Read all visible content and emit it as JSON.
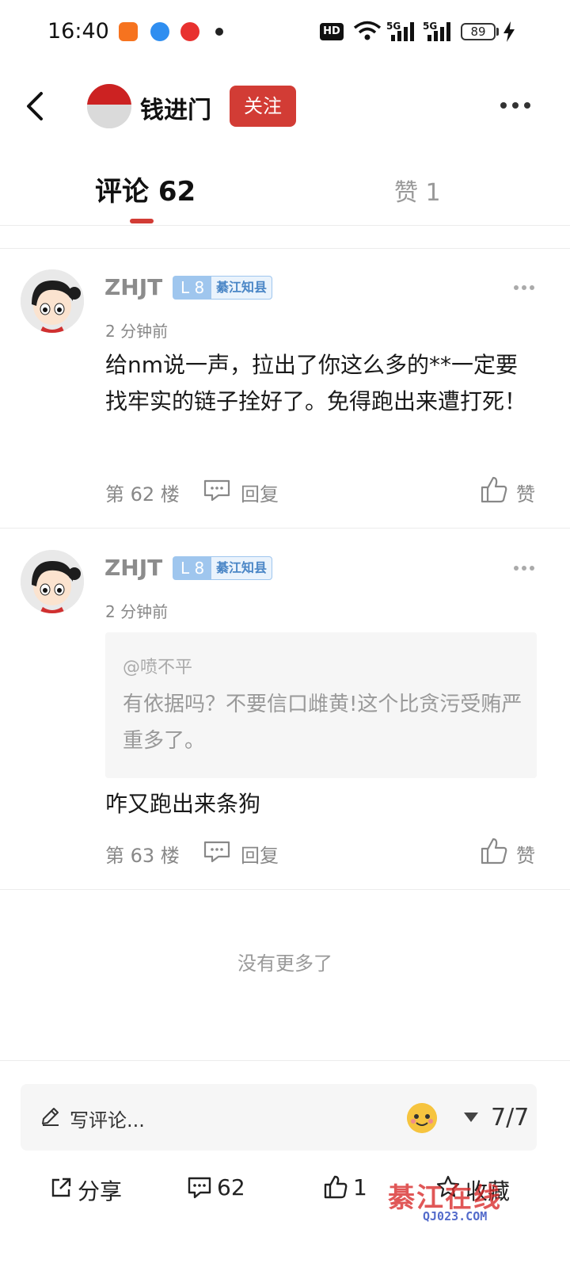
{
  "status_bar": {
    "time": "16:40",
    "network_1": "5G",
    "network_2": "5G",
    "hd": "HD",
    "battery": "89"
  },
  "header": {
    "name": "钱进门",
    "follow_label": "关注"
  },
  "tabs": {
    "comments_label": "评论 62",
    "likes_label": "赞 1"
  },
  "comments": [
    {
      "user": "ZHJT",
      "level": "L 8",
      "title": "綦江知县",
      "time": "2 分钟前",
      "text": "给nm说一声，拉出了你这么多的**一定要找牢实的链子拴好了。免得跑出来遭打死！",
      "floor": "第 62 楼",
      "reply_label": "回复",
      "like_label": "赞"
    },
    {
      "user": "ZHJT",
      "level": "L 8",
      "title": "綦江知县",
      "time": "2 分钟前",
      "quote_user": "@喷不平",
      "quote_text": "有依据吗？不要信口雌黄!这个比贪污受贿严重多了。",
      "text": "咋又跑出来条狗",
      "floor": "第 63 楼",
      "reply_label": "回复",
      "like_label": "赞"
    }
  ],
  "footer_note": "没有更多了",
  "bottom": {
    "write_placeholder": "写评论...",
    "page": "7/7",
    "share_label": "分享",
    "comment_count": "62",
    "like_count": "1",
    "favorite_label": "收藏"
  },
  "watermark": {
    "line1": "綦江在线",
    "line2": "QJ023.COM"
  },
  "colors": {
    "accent": "#d23c35",
    "badge_blue": "#9fc6ee"
  }
}
